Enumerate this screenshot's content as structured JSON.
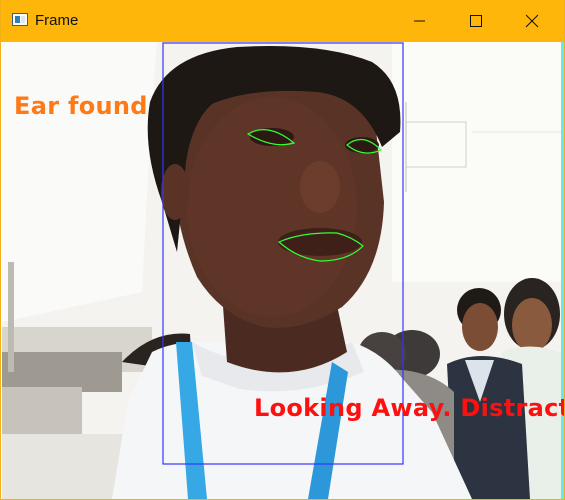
{
  "window": {
    "title": "Frame",
    "icon": "app-window-icon",
    "controls": [
      "minimize-icon",
      "maximize-icon",
      "close-icon"
    ]
  },
  "frame": {
    "ear_label": "Ear found",
    "status_label": "Looking Away. Distract",
    "colors": {
      "titlebar": "#ffb60b",
      "ear_label": "#ff7a17",
      "status_label": "#ff1010",
      "face_box": "#3434ff",
      "landmarks": "#33ff33",
      "edge": "#61ebea"
    }
  }
}
